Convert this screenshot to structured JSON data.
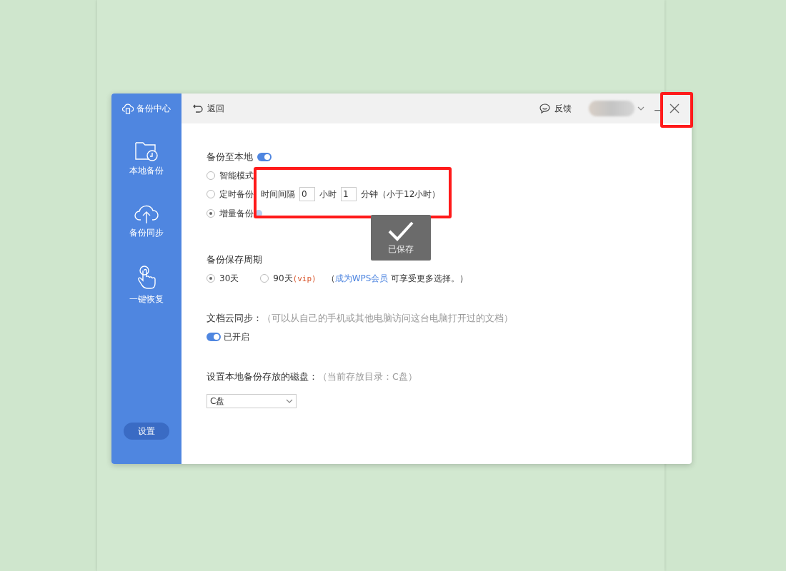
{
  "sidebar": {
    "title": "备份中心",
    "items": [
      {
        "label": "本地备份",
        "kind": "folder"
      },
      {
        "label": "备份同步",
        "kind": "cloud"
      },
      {
        "label": "一键恢复",
        "kind": "hand"
      }
    ],
    "settings_button": "设置"
  },
  "header": {
    "back": "返回",
    "feedback": "反馈"
  },
  "local_backup": {
    "label": "备份至本地",
    "on": true,
    "modes": [
      {
        "label": "智能模式",
        "selected": false
      },
      {
        "label": "定时备份",
        "selected": false
      },
      {
        "label": "增量备份",
        "selected": true
      }
    ],
    "interval": {
      "prefix": "时间间隔",
      "hours": "0",
      "hours_unit": "小时",
      "minutes": "1",
      "minutes_unit": "分钟（小于12小时）"
    }
  },
  "retention": {
    "title": "备份保存周期",
    "options": [
      {
        "label": "30天",
        "selected": true
      },
      {
        "label": "90天",
        "tag": "(vip)",
        "selected": false
      }
    ],
    "note_open": "（",
    "link": "成为WPS会员",
    "note": "可享受更多选择。）"
  },
  "cloud_sync": {
    "title": "文档云同步：",
    "note": "（可以从自己的手机或其他电脑访问这台电脑打开过的文档）",
    "on": true,
    "state_label": "已开启"
  },
  "disk": {
    "title": "设置本地备份存放的磁盘：",
    "note": "（当前存放目录：C盘）",
    "value": "C盘"
  },
  "toast": {
    "text": "已保存"
  }
}
